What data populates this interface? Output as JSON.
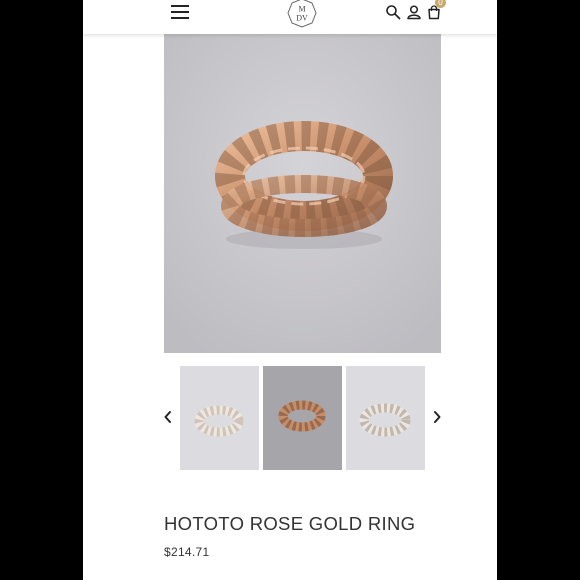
{
  "header": {
    "menu_icon": "hamburger-menu-icon",
    "logo_text": "MDV",
    "search_icon": "search-icon",
    "account_icon": "user-icon",
    "cart_icon": "shopping-bag-icon",
    "cart_count": "0",
    "accent_color": "#c9a96e"
  },
  "product": {
    "title": "HOTOTO ROSE GOLD RING",
    "price": "$214.71"
  },
  "gallery": {
    "prev_icon": "chevron-left-icon",
    "next_icon": "chevron-right-icon",
    "thumbnails": [
      "silver-ring-thumbnail",
      "rose-gold-ring-thumbnail",
      "silver-ring-thumbnail"
    ],
    "selected_index": 1
  }
}
